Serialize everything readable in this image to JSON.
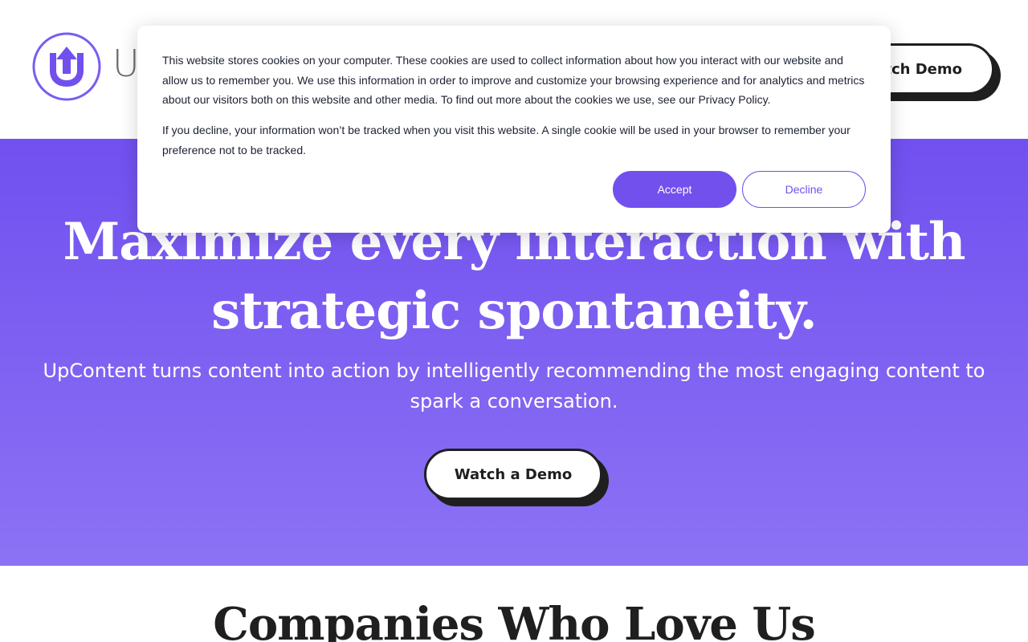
{
  "header": {
    "logo_text": "U",
    "cta_label": "Watch Demo"
  },
  "hero": {
    "title_line1": "Maximize every interaction with",
    "title_line2": "strategic spontaneity.",
    "subtitle": "UpContent turns content into action by intelligently recommending the most engaging content to spark a conversation.",
    "cta_label": "Watch a Demo"
  },
  "companies": {
    "title": "Companies Who Love Us"
  },
  "cookie_banner": {
    "paragraph1": "This website stores cookies on your computer. These cookies are used to collect information about how you interact with our website and allow us to remember you. We use this information in order to improve and customize your browsing experience and for analytics and metrics about our visitors both on this website and other media. To find out more about the cookies we use, see our Privacy Policy.",
    "paragraph2": "If you decline, your information won’t be tracked when you visit this website. A single cookie will be used in your browser to remember your preference not to be tracked.",
    "accept_label": "Accept",
    "decline_label": "Decline"
  },
  "colors": {
    "brand_purple": "#7150ee",
    "hero_gradient_top": "#7150f0",
    "hero_gradient_bottom": "#8c72f4",
    "dark": "#1f1f1f"
  },
  "icons": {
    "logo": "upcontent-logo-icon"
  }
}
